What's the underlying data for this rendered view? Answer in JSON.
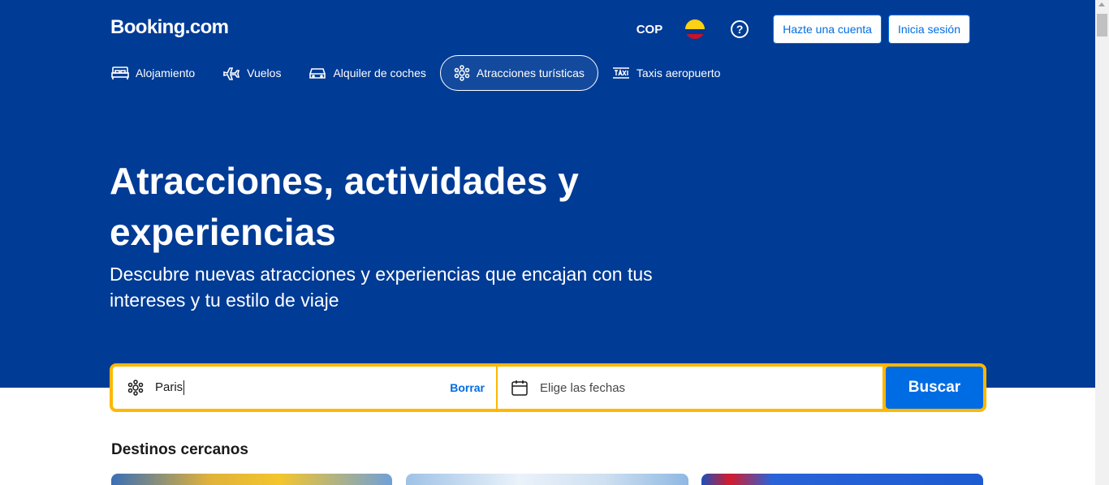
{
  "header": {
    "logo": "Booking.com",
    "currency": "COP",
    "help_symbol": "?",
    "register_label": "Hazte una cuenta",
    "login_label": "Inicia sesión"
  },
  "nav": {
    "items": [
      {
        "label": "Alojamiento",
        "icon": "bed-icon"
      },
      {
        "label": "Vuelos",
        "icon": "plane-icon"
      },
      {
        "label": "Alquiler de coches",
        "icon": "car-icon"
      },
      {
        "label": "Atracciones turísticas",
        "icon": "attractions-icon",
        "active": true
      },
      {
        "label": "Taxis aeropuerto",
        "icon": "taxi-icon"
      }
    ]
  },
  "hero": {
    "title": "Atracciones, actividades y experiencias",
    "subtitle": "Descubre nuevas atracciones y experiencias que encajan con tus intereses y tu estilo de viaje"
  },
  "search": {
    "destination_value": "Paris",
    "clear_label": "Borrar",
    "date_placeholder": "Elige las fechas",
    "button_label": "Buscar"
  },
  "section": {
    "title": "Destinos cercanos"
  },
  "colors": {
    "brand_blue": "#003b95",
    "accent_yellow": "#ffb700",
    "button_blue": "#006ce4"
  }
}
